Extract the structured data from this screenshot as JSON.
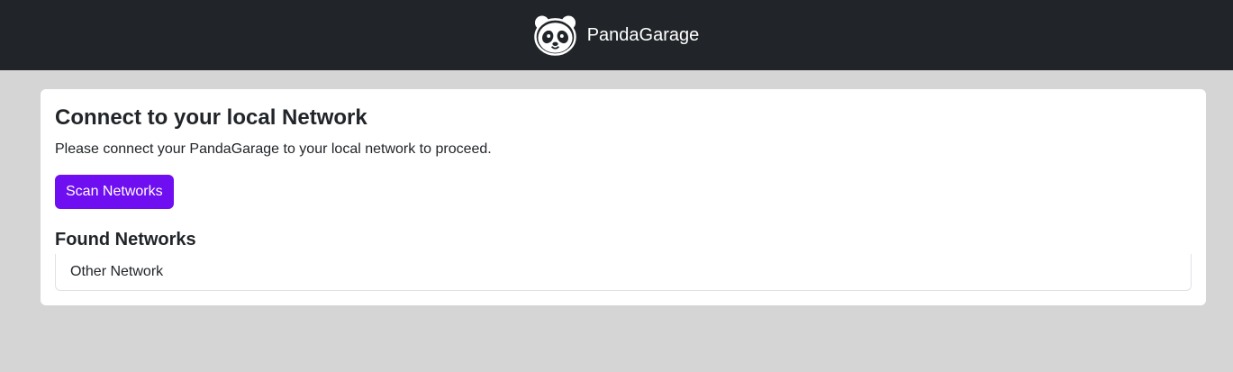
{
  "navbar": {
    "brand_name": "PandaGarage",
    "logo_icon": "panda-logo-icon"
  },
  "card": {
    "title": "Connect to your local Network",
    "description": "Please connect your PandaGarage to your local network to proceed.",
    "scan_button_label": "Scan Networks",
    "found_title": "Found Networks",
    "networks": [
      {
        "label": "Other Network"
      }
    ]
  },
  "colors": {
    "navbar_bg": "#212529",
    "page_bg": "#d5d5d5",
    "accent": "#6f0ef0"
  }
}
